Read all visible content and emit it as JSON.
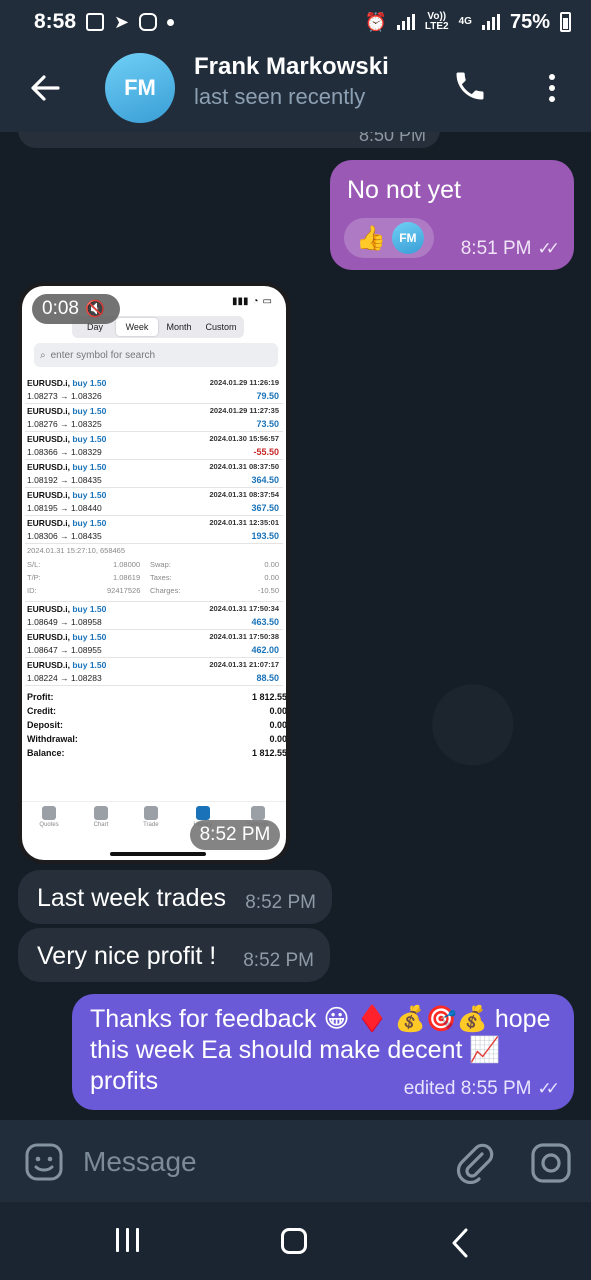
{
  "status_bar": {
    "time": "8:58",
    "network_label_top": "Vo))",
    "network_label_bottom": "LTE2",
    "network_type": "4G",
    "battery": "75%"
  },
  "header": {
    "contact_name": "Frank Markowski",
    "avatar_initials": "FM",
    "status": "last seen recently"
  },
  "messages": {
    "previous_time": "8:50 PM",
    "no_not_yet": {
      "text": "No not yet",
      "reaction_emoji": "👍",
      "reaction_avatar": "FM",
      "time": "8:51 PM"
    },
    "image": {
      "video_duration": "0:08",
      "time": "8:52 PM",
      "screenshot": {
        "tabs": [
          "Day",
          "Week",
          "Month",
          "Custom"
        ],
        "active_tab": "Week",
        "search_placeholder": "enter symbol for search",
        "trades": [
          {
            "symbol": "EURUSD.i,",
            "action": "buy 1.50",
            "prices": "1.08273 → 1.08326",
            "datetime": "2024.01.29 11:26:19",
            "profit": "79.50"
          },
          {
            "symbol": "EURUSD.i,",
            "action": "buy 1.50",
            "prices": "1.08276 → 1.08325",
            "datetime": "2024.01.29 11:27:35",
            "profit": "73.50"
          },
          {
            "symbol": "EURUSD.i,",
            "action": "buy 1.50",
            "prices": "1.08366 → 1.08329",
            "datetime": "2024.01.30 15:56:57",
            "profit": "-55.50"
          },
          {
            "symbol": "EURUSD.i,",
            "action": "buy 1.50",
            "prices": "1.08192 → 1.08435",
            "datetime": "2024.01.31 08:37:50",
            "profit": "364.50"
          },
          {
            "symbol": "EURUSD.i,",
            "action": "buy 1.50",
            "prices": "1.08195 → 1.08440",
            "datetime": "2024.01.31 08:37:54",
            "profit": "367.50"
          },
          {
            "symbol": "EURUSD.i,",
            "action": "buy 1.50",
            "prices": "1.08306 → 1.08435",
            "datetime": "2024.01.31 12:35:01",
            "profit": "193.50"
          }
        ],
        "detail": {
          "header": "2024.01.31 15:27:10, 658465",
          "sl_label": "S/L:",
          "sl": "1.08000",
          "swap_label": "Swap:",
          "swap": "0.00",
          "tp_label": "T/P:",
          "tp": "1.08619",
          "taxes_label": "Taxes:",
          "taxes": "0.00",
          "id_label": "ID:",
          "id": "92417526",
          "charges_label": "Charges:",
          "charges": "-10.50"
        },
        "trades2": [
          {
            "symbol": "EURUSD.i,",
            "action": "buy 1.50",
            "prices": "1.08649 → 1.08958",
            "datetime": "2024.01.31 17:50:34",
            "profit": "463.50"
          },
          {
            "symbol": "EURUSD.i,",
            "action": "buy 1.50",
            "prices": "1.08647 → 1.08955",
            "datetime": "2024.01.31 17:50:38",
            "profit": "462.00"
          },
          {
            "symbol": "EURUSD.i,",
            "action": "buy 1.50",
            "prices": "1.08224 → 1.08283",
            "datetime": "2024.01.31 21:07:17",
            "profit": "88.50"
          }
        ],
        "summary": [
          {
            "label": "Profit:",
            "value": "1 812.55"
          },
          {
            "label": "Credit:",
            "value": "0.00"
          },
          {
            "label": "Deposit:",
            "value": "0.00"
          },
          {
            "label": "Withdrawal:",
            "value": "0.00"
          },
          {
            "label": "Balance:",
            "value": "1 812.55"
          }
        ],
        "nav": [
          "Quotes",
          "Chart",
          "Trade",
          "History",
          "Settings"
        ]
      }
    },
    "last_week": {
      "text": "Last week trades",
      "time": "8:52 PM"
    },
    "nice_profit": {
      "text": "Very nice profit !",
      "time": "8:52 PM"
    },
    "thanks": {
      "text": "Thanks for feedback 😀 ♦️ 💰🎯💰 hope this week Ea should make decent 📈 profits",
      "time": "edited 8:55 PM"
    }
  },
  "input": {
    "placeholder": "Message"
  },
  "colors": {
    "outgoing_purple": "#9b59b6",
    "outgoing_indigo": "#6a5ad8",
    "incoming": "#262f3a",
    "header": "#212d3b"
  }
}
